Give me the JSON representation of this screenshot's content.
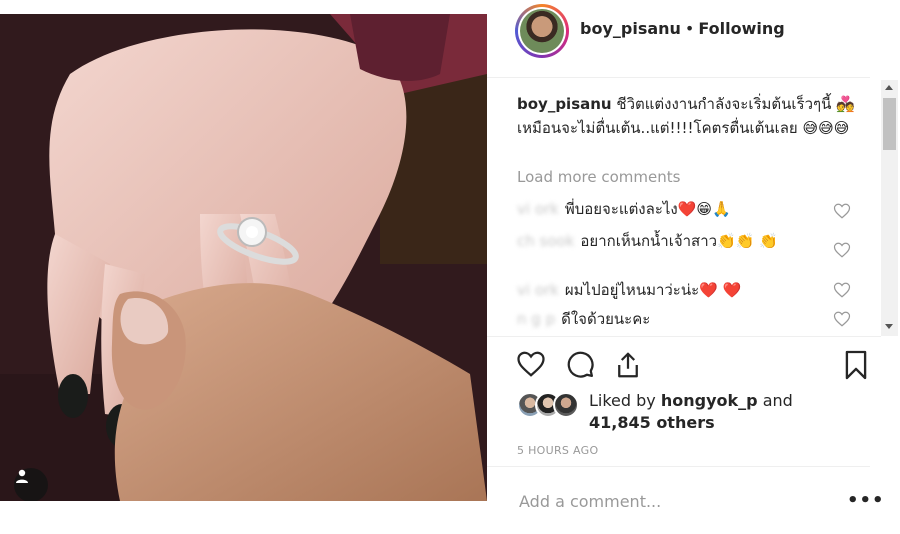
{
  "post": {
    "username": "boy_pisanu",
    "separator": "•",
    "follow_status": "Following",
    "caption_text": "ชีวิตแต่งงานกำลังจะเริ่มต้นเร็วๆนี้ 💑 เหมือนจะไม่ตื่นเต้น..แต่!!!!โคตรตื่นเต้นเลย 😅😅😅",
    "load_more": "Load more comments",
    "comments": [
      {
        "user": "vi ork",
        "text": "พี่บอยจะแต่งละไง❤️😁🙏"
      },
      {
        "user": "ch sook",
        "text": "อยากเห็นกน้ำเจ้าสาว👏👏 👏"
      },
      {
        "user": "vi ork",
        "text": "ผมไปอยู่ไหนมาว่ะน่ะ❤️ ❤️"
      },
      {
        "user": "n g p",
        "text": "ดีใจด้วยนะคะ"
      }
    ],
    "liked_by_prefix": "Liked by ",
    "liked_by_user": "hongyok_p",
    "liked_by_and": " and",
    "liked_by_others": "41,845 others",
    "time_ago": "5 HOURS AGO",
    "add_comment_placeholder": "Add a comment...",
    "more_options": "•••"
  },
  "icons": {
    "heart": "heart-icon",
    "comment": "comment-icon",
    "share": "share-icon",
    "bookmark": "bookmark-icon",
    "user_tag": "user-tag-icon"
  },
  "colors": {
    "text": "#262626",
    "muted": "#999999",
    "border": "#efefef"
  }
}
